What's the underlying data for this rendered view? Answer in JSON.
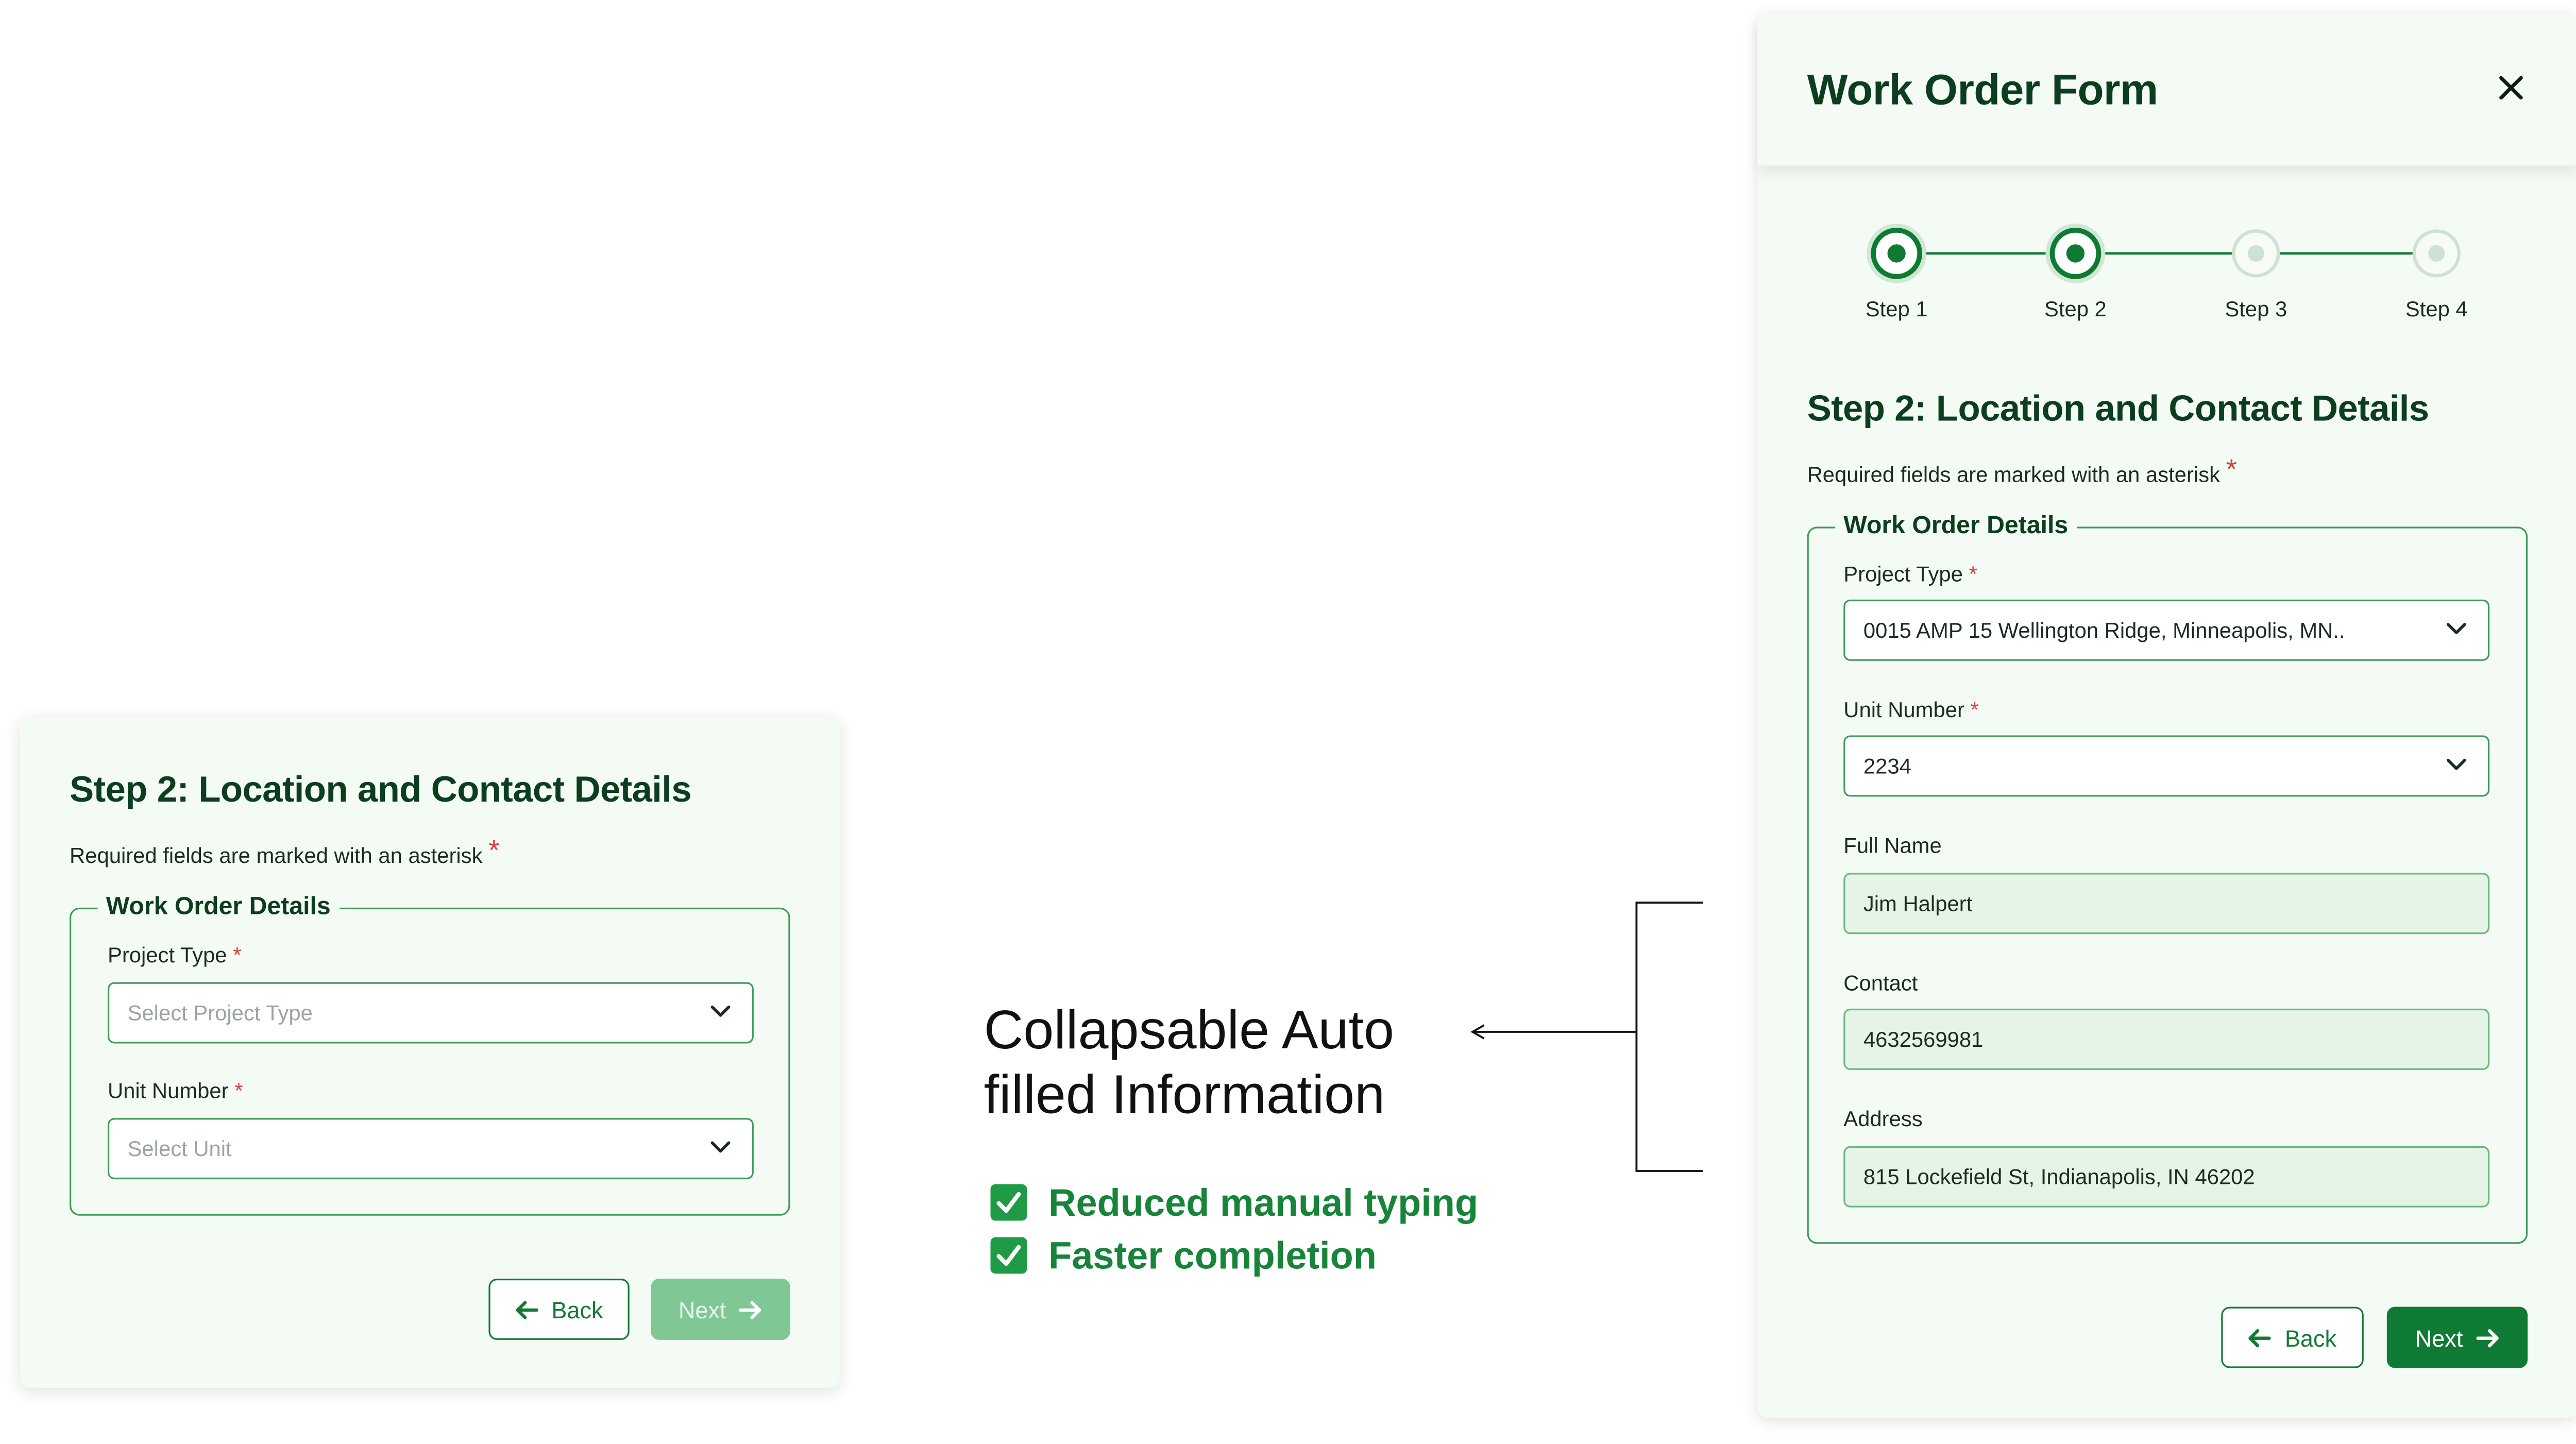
{
  "left_card": {
    "heading": "Step 2: Location and Contact Details",
    "required_note": "Required fields are marked with an asterisk",
    "required_star": "*",
    "legend": "Work Order Details",
    "fields": [
      {
        "label": "Project Type",
        "required": "*",
        "placeholder": "Select Project Type"
      },
      {
        "label": "Unit Number",
        "required": "*",
        "placeholder": "Select Unit"
      }
    ],
    "back_label": "Back",
    "next_label": "Next"
  },
  "annotation": {
    "line1": "Collapsable Auto",
    "line2": "filled Information",
    "benefits": [
      "Reduced manual typing",
      "Faster completion"
    ]
  },
  "modal": {
    "title": "Work Order Form",
    "close_icon": "close-icon",
    "steps": [
      {
        "label": "Step 1",
        "state": "completed"
      },
      {
        "label": "Step 2",
        "state": "active"
      },
      {
        "label": "Step 3",
        "state": "pending"
      },
      {
        "label": "Step 4",
        "state": "pending"
      }
    ],
    "heading": "Step 2: Location and Contact Details",
    "required_note": "Required fields are marked with an asterisk",
    "required_star": "*",
    "legend": "Work Order Details",
    "project_type": {
      "label": "Project Type",
      "required": "*",
      "value": "0015 AMP 15 Wellington Ridge, Minneapolis, MN.."
    },
    "unit_number": {
      "label": "Unit Number",
      "required": "*",
      "value": "2234"
    },
    "full_name": {
      "label": "Full Name",
      "value": "Jim Halpert"
    },
    "contact": {
      "label": "Contact",
      "value": "4632569981"
    },
    "address": {
      "label": "Address",
      "value": "815 Lockefield St, Indianapolis, IN 46202"
    },
    "back_label": "Back",
    "next_label": "Next"
  },
  "colors": {
    "brand_green": "#0f7a33",
    "heading_green": "#0b3d1e",
    "card_bg": "#f3fbf4",
    "required": "#e03a3a"
  }
}
